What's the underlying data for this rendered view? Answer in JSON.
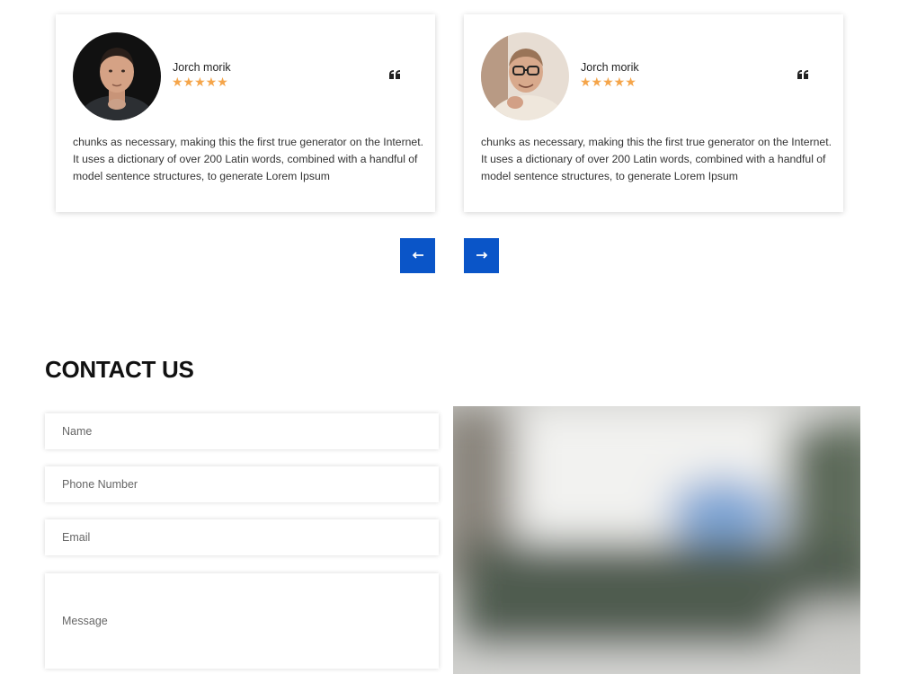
{
  "testimonials": [
    {
      "author": "Jorch morik",
      "rating": 5,
      "stars_text": "★★★★★",
      "text": "chunks as necessary, making this the first true generator on the Internet. It uses a dictionary of over 200 Latin words, combined with a handful of model sentence structures, to generate Lorem Ipsum"
    },
    {
      "author": "Jorch morik",
      "rating": 5,
      "stars_text": "★★★★★",
      "text": "chunks as necessary, making this the first true generator on the Internet. It uses a dictionary of over 200 Latin words, combined with a handful of model sentence structures, to generate Lorem Ipsum"
    }
  ],
  "slider": {
    "prev_icon": "arrow-left-icon",
    "next_icon": "arrow-right-icon"
  },
  "contact": {
    "title": "CONTACT US",
    "fields": {
      "name_placeholder": "Name",
      "phone_placeholder": "Phone Number",
      "email_placeholder": "Email",
      "message_placeholder": "Message"
    }
  },
  "colors": {
    "accent": "#0a55c8",
    "star": "#f5a54a",
    "text": "#333333"
  }
}
